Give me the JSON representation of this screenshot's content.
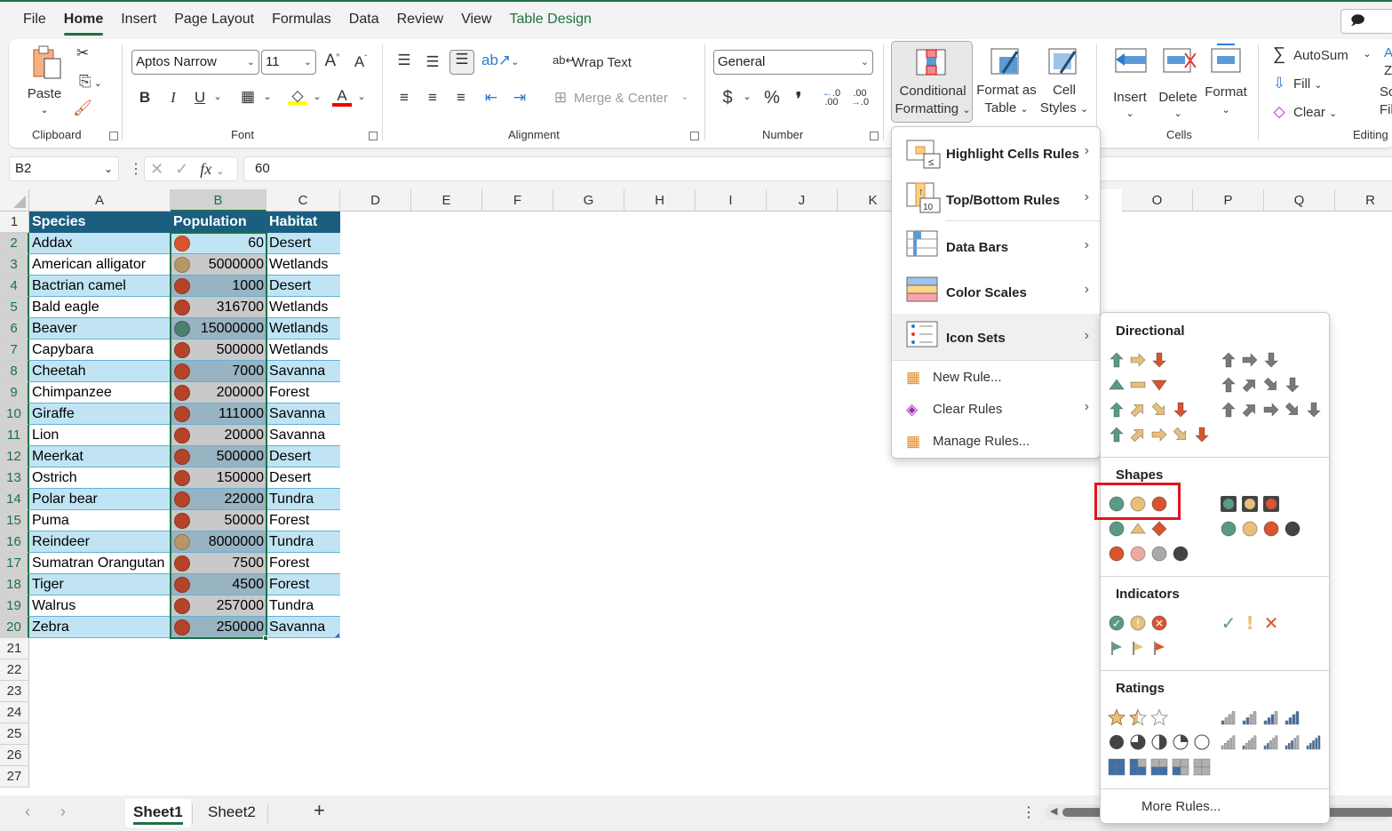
{
  "ribbon_tabs": [
    "File",
    "Home",
    "Insert",
    "Page Layout",
    "Formulas",
    "Data",
    "Review",
    "View",
    "Table Design"
  ],
  "active_tab": "Home",
  "comments_button": "Com",
  "clipboard": {
    "paste": "Paste",
    "group": "Clipboard"
  },
  "font": {
    "name": "Aptos Narrow",
    "size": "11",
    "group": "Font",
    "bold": "B",
    "italic": "I",
    "underline": "U"
  },
  "alignment": {
    "wrap_text": "Wrap Text",
    "merge_center": "Merge & Center",
    "group": "Alignment"
  },
  "number": {
    "format": "General",
    "currency": "$",
    "percent": "%",
    "comma": "❜",
    "group": "Number"
  },
  "styles": {
    "conditional_formatting_line1": "Conditional",
    "conditional_formatting_line2": "Formatting",
    "format_as_table_line1": "Format as",
    "format_as_table_line2": "Table",
    "cell_styles_line1": "Cell",
    "cell_styles_line2": "Styles"
  },
  "cells": {
    "insert": "Insert",
    "delete": "Delete",
    "format": "Format",
    "group": "Cells"
  },
  "editing": {
    "autosum": "AutoSum",
    "fill": "Fill",
    "clear": "Clear",
    "sort_partial_1": "Sc",
    "sort_partial_2": "Fil",
    "group": "Editing"
  },
  "formula_bar": {
    "name_box": "B2",
    "fx": "fx",
    "value": "60"
  },
  "columns": [
    "A",
    "B",
    "C",
    "D",
    "E",
    "F",
    "G",
    "H",
    "I",
    "J",
    "K",
    "O",
    "P",
    "Q",
    "R"
  ],
  "rows": [
    "1",
    "2",
    "3",
    "4",
    "5",
    "6",
    "7",
    "8",
    "9",
    "10",
    "11",
    "12",
    "13",
    "14",
    "15",
    "16",
    "17",
    "18",
    "19",
    "20",
    "21",
    "22",
    "23",
    "24",
    "25",
    "26",
    "27"
  ],
  "table": {
    "headers": [
      "Species",
      "Population",
      "Habitat"
    ],
    "rows": [
      {
        "species": "Addax",
        "population": "60",
        "habitat": "Desert",
        "icon": "red"
      },
      {
        "species": "American alligator",
        "population": "5000000",
        "habitat": "Wetlands",
        "icon": "yellow"
      },
      {
        "species": "Bactrian camel",
        "population": "1000",
        "habitat": "Desert",
        "icon": "red"
      },
      {
        "species": "Bald eagle",
        "population": "316700",
        "habitat": "Wetlands",
        "icon": "red"
      },
      {
        "species": "Beaver",
        "population": "15000000",
        "habitat": "Wetlands",
        "icon": "green"
      },
      {
        "species": "Capybara",
        "population": "500000",
        "habitat": "Wetlands",
        "icon": "red"
      },
      {
        "species": "Cheetah",
        "population": "7000",
        "habitat": "Savanna",
        "icon": "red"
      },
      {
        "species": "Chimpanzee",
        "population": "200000",
        "habitat": "Forest",
        "icon": "red"
      },
      {
        "species": "Giraffe",
        "population": "111000",
        "habitat": "Savanna",
        "icon": "red"
      },
      {
        "species": "Lion",
        "population": "20000",
        "habitat": "Savanna",
        "icon": "red"
      },
      {
        "species": "Meerkat",
        "population": "500000",
        "habitat": "Desert",
        "icon": "red"
      },
      {
        "species": "Ostrich",
        "population": "150000",
        "habitat": "Desert",
        "icon": "red"
      },
      {
        "species": "Polar bear",
        "population": "22000",
        "habitat": "Tundra",
        "icon": "red"
      },
      {
        "species": "Puma",
        "population": "50000",
        "habitat": "Forest",
        "icon": "red"
      },
      {
        "species": "Reindeer",
        "population": "8000000",
        "habitat": "Tundra",
        "icon": "yellow"
      },
      {
        "species": "Sumatran Orangutan",
        "population": "7500",
        "habitat": "Forest",
        "icon": "red"
      },
      {
        "species": "Tiger",
        "population": "4500",
        "habitat": "Forest",
        "icon": "red"
      },
      {
        "species": "Walrus",
        "population": "257000",
        "habitat": "Tundra",
        "icon": "red"
      },
      {
        "species": "Zebra",
        "population": "250000",
        "habitat": "Savanna",
        "icon": "red"
      }
    ]
  },
  "icon_colors": {
    "red": "#b5432a",
    "red_first": "#d9542f",
    "yellow": "#b8966a",
    "green": "#4e7e6e"
  },
  "cf_menu": {
    "items": [
      {
        "label": "Highlight Cells Rules",
        "icon": "highlight-cells-icon",
        "submenu": true
      },
      {
        "label": "Top/Bottom Rules",
        "icon": "top-bottom-icon",
        "submenu": true
      },
      {
        "label": "Data Bars",
        "icon": "data-bars-icon",
        "submenu": true
      },
      {
        "label": "Color Scales",
        "icon": "color-scales-icon",
        "submenu": true
      },
      {
        "label": "Icon Sets",
        "icon": "icon-sets-icon",
        "submenu": true
      },
      {
        "label": "New Rule...",
        "icon": "new-rule-icon",
        "submenu": false
      },
      {
        "label": "Clear Rules",
        "icon": "clear-rules-icon",
        "submenu": true
      },
      {
        "label": "Manage Rules...",
        "icon": "manage-rules-icon",
        "submenu": false
      }
    ]
  },
  "icon_sets_menu": {
    "sections": [
      "Directional",
      "Shapes",
      "Indicators",
      "Ratings"
    ],
    "more_rules": "More Rules...",
    "highlighted_set": "3 Traffic Lights (Unrimmed)"
  },
  "sheets": [
    "Sheet1",
    "Sheet2"
  ],
  "active_sheet": "Sheet1",
  "colors": {
    "accent": "#1e7145",
    "table_header": "#1a5e80",
    "band": "#c0e4f4",
    "highlight_box": "#e3141e",
    "green_icon": "#5a9a87",
    "yellow_icon": "#e8c07a",
    "red_icon": "#d9542f"
  }
}
